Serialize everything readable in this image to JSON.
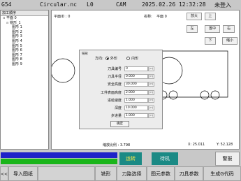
{
  "topbar": {
    "mode": "G54",
    "file": "Circular.nc",
    "layer": "L0",
    "app": "CAM",
    "datetime": "2025.02.26 12:32:28",
    "login": "未登入"
  },
  "tree": {
    "title": "加工顺序",
    "root": "平面 0",
    "group": "铣形_1",
    "items": [
      "图形 1",
      "图形 2",
      "图形 3",
      "图形 4",
      "图形 5",
      "图形 6",
      "图形 7",
      "图形 8",
      "图形 9"
    ]
  },
  "canvas": {
    "plane_id": "平面ID : 0",
    "name_label": "名称:",
    "name_value": "平面 0",
    "zoom_in": "放大",
    "up": "上",
    "left": "左",
    "center": "置中",
    "right": "右",
    "down": "下",
    "zoom_out": "缩小",
    "scale_label": "缩放比例 : ",
    "scale_value": "3.798",
    "x_label": "X: ",
    "x_value": "25.011",
    "y_label": "Y: ",
    "y_value": "52.128"
  },
  "dialog": {
    "title": "铣形",
    "direction_label": "方向:",
    "outside_label": "外形",
    "inside_label": "内形",
    "selected_direction": "外形",
    "fields": [
      {
        "label": "刀具编号",
        "value": "0",
        "unit": "(n)"
      },
      {
        "label": "刀具半径",
        "value": "0.000",
        "unit": "(n)"
      },
      {
        "label": "安全高度",
        "value": "30.000",
        "unit": "(n)"
      },
      {
        "label": "工件表面高度",
        "value": "2.000",
        "unit": "(n)"
      },
      {
        "label": "进给速度",
        "value": "1.000",
        "unit": "(n)"
      },
      {
        "label": "深度",
        "value": "10.000",
        "unit": "(n)"
      },
      {
        "label": "步进量",
        "value": "1.000",
        "unit": "(n)"
      }
    ],
    "ok": "确定"
  },
  "status": {
    "btn1": "运转",
    "btn2": "待机",
    "alarm": "警报"
  },
  "bottom": {
    "back": "<<",
    "import": "导入图纸",
    "mill": "铣形",
    "path_select": "刀路选择",
    "shape_params": "图元参数",
    "tool_params": "刀具参数",
    "gen_gcode": "生成G代码"
  },
  "colors": {
    "progress_blue": "#1f22c8",
    "progress_green": "#1ab51a",
    "run_button": "#1b8a85",
    "standby_button": "#1b8a85"
  }
}
